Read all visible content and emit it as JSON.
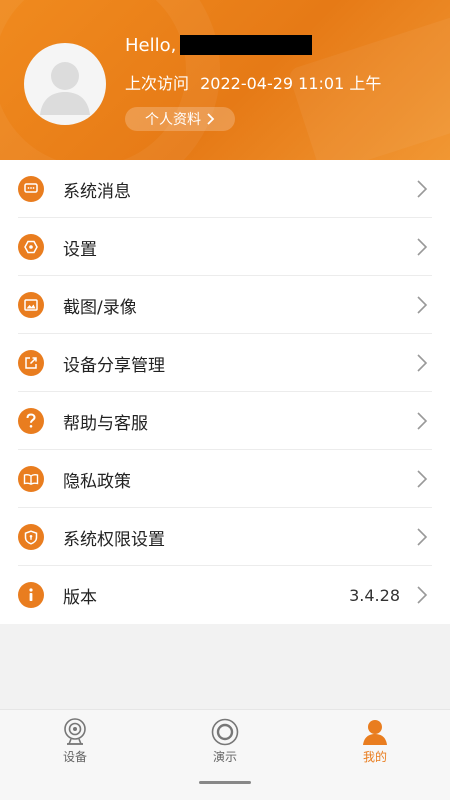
{
  "header": {
    "hello": "Hello,",
    "last_visit_label": "上次访问",
    "last_visit_time": "2022-04-29 11:01 上午",
    "profile_button": "个人资料",
    "accent": "#e97d1f"
  },
  "menu": {
    "items": [
      {
        "label": "系统消息",
        "icon": "message-icon"
      },
      {
        "label": "设置",
        "icon": "settings-icon"
      },
      {
        "label": "截图/录像",
        "icon": "image-icon"
      },
      {
        "label": "设备分享管理",
        "icon": "share-icon"
      },
      {
        "label": "帮助与客服",
        "icon": "help-icon"
      },
      {
        "label": "隐私政策",
        "icon": "book-icon"
      },
      {
        "label": "系统权限设置",
        "icon": "shield-icon"
      },
      {
        "label": "版本",
        "icon": "info-icon",
        "value": "3.4.28"
      }
    ]
  },
  "bottom_nav": {
    "tabs": [
      {
        "label": "设备",
        "icon": "camera-icon"
      },
      {
        "label": "演示",
        "icon": "demo-icon"
      },
      {
        "label": "我的",
        "icon": "person-icon",
        "active": true
      }
    ]
  }
}
